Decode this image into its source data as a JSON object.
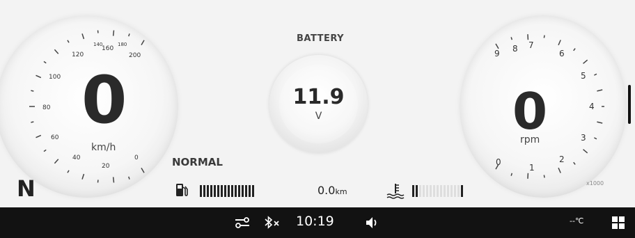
{
  "speedometer": {
    "value": "0",
    "unit": "km/h",
    "ticks": [
      "0",
      "20",
      "40",
      "60",
      "80",
      "100",
      "120",
      "140",
      "160",
      "180",
      "200"
    ]
  },
  "battery": {
    "title": "BATTERY",
    "value": "11.9",
    "unit": "V"
  },
  "tachometer": {
    "value": "0",
    "unit": "rpm",
    "ticks": [
      "0",
      "1",
      "2",
      "3",
      "4",
      "5",
      "6",
      "7",
      "8",
      "9"
    ],
    "multiplier": "x1000"
  },
  "drive_mode": "NORMAL",
  "gear": "N",
  "odometer": {
    "value": "0.0",
    "unit": "km"
  },
  "fuel_level_fraction": 1.0,
  "coolant_level_fraction": 0.1,
  "status_bar": {
    "time": "10:19",
    "outside_temp": "--℃",
    "icons": [
      "connection-icon",
      "bluetooth-off-icon",
      "volume-icon",
      "grid-menu-icon"
    ]
  },
  "colors": {
    "background": "#f3f3f3",
    "status_bar": "#121212",
    "digit": "#2a2a2a"
  }
}
